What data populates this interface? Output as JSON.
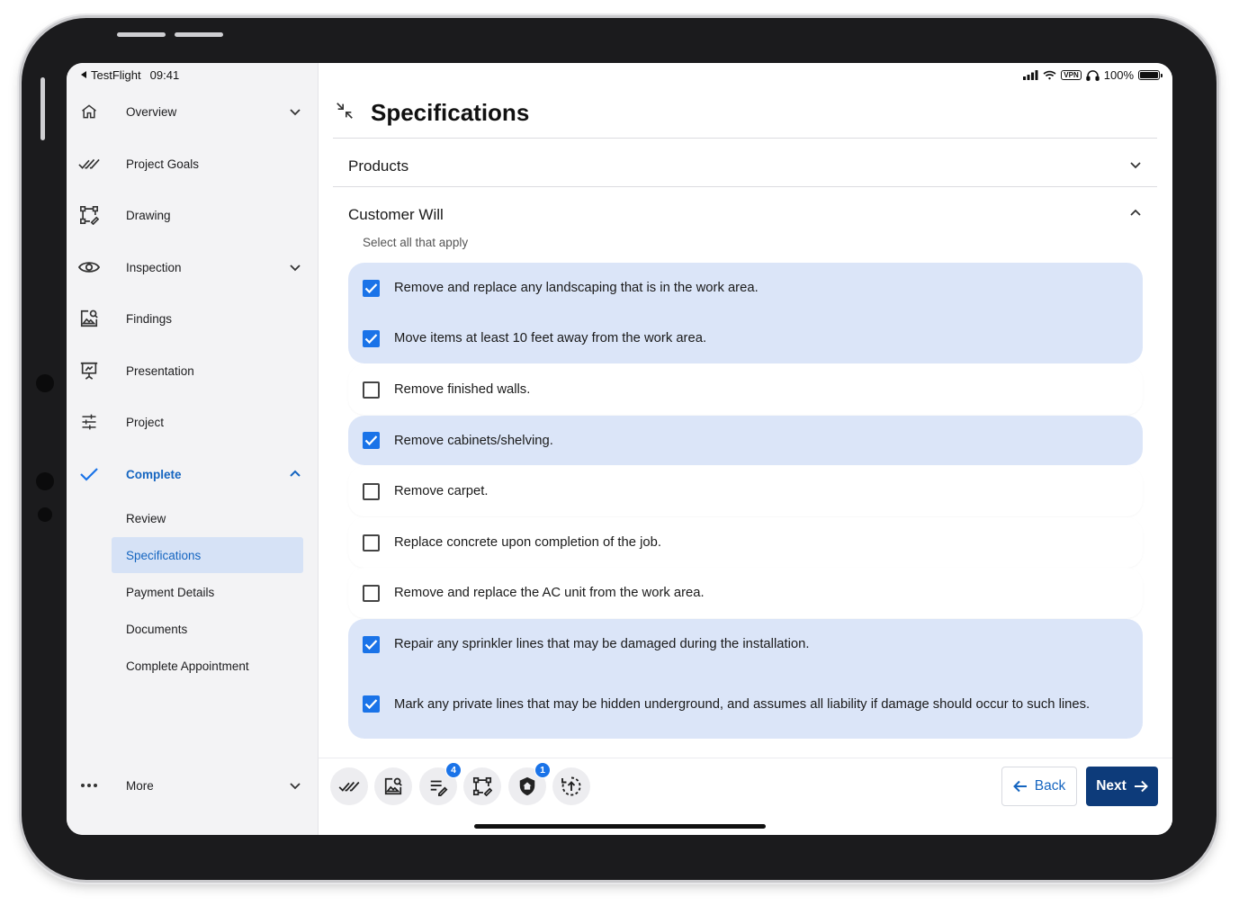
{
  "status": {
    "back_app": "TestFlight",
    "time": "09:41",
    "vpn": "VPN",
    "battery": "100%"
  },
  "sidebar": {
    "items": [
      {
        "label": "Overview",
        "icon": "home-icon",
        "has_chevron": true
      },
      {
        "label": "Project Goals",
        "icon": "double-check-icon",
        "has_chevron": false
      },
      {
        "label": "Drawing",
        "icon": "draw-shape-icon",
        "has_chevron": false
      },
      {
        "label": "Inspection",
        "icon": "eye-icon",
        "has_chevron": true
      },
      {
        "label": "Findings",
        "icon": "image-search-icon",
        "has_chevron": false
      },
      {
        "label": "Presentation",
        "icon": "presentation-icon",
        "has_chevron": false
      },
      {
        "label": "Project",
        "icon": "sliders-icon",
        "has_chevron": false
      },
      {
        "label": "Complete",
        "icon": "check-icon",
        "has_chevron": true,
        "expanded": true
      }
    ],
    "sub_items": [
      "Review",
      "Specifications",
      "Payment Details",
      "Documents",
      "Complete Appointment"
    ],
    "selected_sub": "Specifications",
    "more_label": "More"
  },
  "main": {
    "title": "Specifications",
    "products_label": "Products",
    "customer_will_label": "Customer Will",
    "hint": "Select all that apply",
    "options": [
      {
        "text": "Remove and replace any landscaping that is in the work area.",
        "checked": true
      },
      {
        "text": "Move items at least 10 feet away from the work area.",
        "checked": true
      },
      {
        "text": "Remove finished walls.",
        "checked": false
      },
      {
        "text": "Remove cabinets/shelving.",
        "checked": true
      },
      {
        "text": "Remove carpet.",
        "checked": false
      },
      {
        "text": "Replace concrete upon completion of the job.",
        "checked": false
      },
      {
        "text": "Remove and replace the AC unit from the work area.",
        "checked": false
      },
      {
        "text": "Repair any sprinkler lines that may be damaged during the installation.",
        "checked": true
      },
      {
        "text": "Mark any private lines that may be hidden underground, and assumes all liability if damage should occur to such lines.",
        "checked": true
      }
    ]
  },
  "toolbar": {
    "tools": [
      {
        "icon": "double-check-icon",
        "badge": ""
      },
      {
        "icon": "image-search-icon",
        "badge": ""
      },
      {
        "icon": "notes-edit-icon",
        "badge": "4"
      },
      {
        "icon": "draw-shape-icon",
        "badge": ""
      },
      {
        "icon": "shield-home-icon",
        "badge": "1"
      },
      {
        "icon": "upload-sync-icon",
        "badge": ""
      }
    ],
    "back_label": "Back",
    "next_label": "Next"
  },
  "colors": {
    "accent": "#1a73e8",
    "active_text": "#1565c0",
    "checked_bg": "#dbe5f8",
    "selected_nav_bg": "#d6e2f6",
    "next_bg": "#0d3b7a",
    "sidebar_bg": "#f3f3f5"
  }
}
